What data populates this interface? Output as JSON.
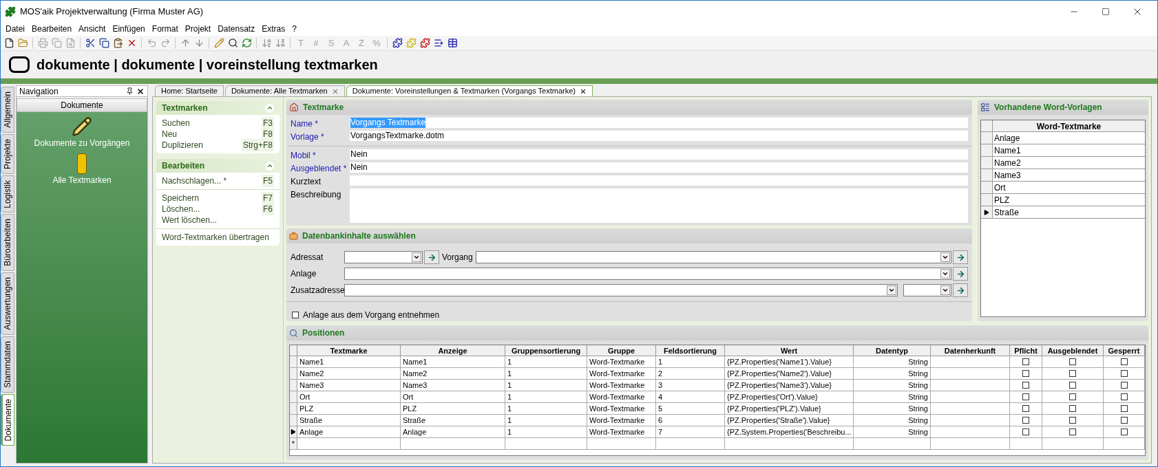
{
  "window": {
    "title": "MOS'aik Projektverwaltung (Firma Muster AG)"
  },
  "menu": [
    "Datei",
    "Bearbeiten",
    "Ansicht",
    "Einfügen",
    "Format",
    "Projekt",
    "Datensatz",
    "Extras",
    "?"
  ],
  "toolbar_glyphs": [
    {
      "label": "T",
      "disabled": true
    },
    {
      "label": "#",
      "disabled": true
    },
    {
      "label": "S",
      "disabled": true
    },
    {
      "label": "A",
      "disabled": true
    },
    {
      "label": "Z",
      "disabled": true
    },
    {
      "label": "%",
      "disabled": true
    }
  ],
  "header": {
    "title": "dokumente | dokumente | voreinstellung textmarken"
  },
  "side_tabs": [
    {
      "label": "Allgemein",
      "selected": false
    },
    {
      "label": "Projekte",
      "selected": false
    },
    {
      "label": "Logistik",
      "selected": false
    },
    {
      "label": "Büroarbeiten",
      "selected": false
    },
    {
      "label": "Auswertungen",
      "selected": false
    },
    {
      "label": "Stammdaten",
      "selected": false
    },
    {
      "label": "Dokumente",
      "selected": true
    }
  ],
  "navigation": {
    "title": "Navigation",
    "group": "Dokumente",
    "items": [
      {
        "label": "Dokumente zu Vorgängen",
        "kind": "pencil"
      },
      {
        "label": "Alle Textmarken",
        "kind": "marker"
      }
    ]
  },
  "doc_tabs": [
    {
      "label": "Home: Startseite",
      "selected": false,
      "closable": false
    },
    {
      "label": "Dokumente: Alle Textmarken",
      "selected": false,
      "closable": true
    },
    {
      "label": "Dokumente: Voreinstellungen & Textmarken (Vorgangs Textmarke)",
      "selected": true,
      "closable": true
    }
  ],
  "task_groups": [
    {
      "title": "Textmarken",
      "sections": [
        [
          {
            "label": "Suchen",
            "shortcut": "F3"
          },
          {
            "label": "Neu",
            "shortcut": "F8"
          },
          {
            "label": "Duplizieren",
            "shortcut": "Strg+F8"
          }
        ]
      ]
    },
    {
      "title": "Bearbeiten",
      "sections": [
        [
          {
            "label": "Nachschlagen... *",
            "shortcut": "F5"
          }
        ],
        [
          {
            "label": "Speichern",
            "shortcut": "F7"
          },
          {
            "label": "Löschen...",
            "shortcut": "F6"
          },
          {
            "label": "Wert löschen..."
          }
        ],
        [
          {
            "label": "Word-Textmarken übertragen"
          }
        ]
      ]
    }
  ],
  "textmarke": {
    "title": "Textmarke",
    "groups": [
      [
        {
          "label": "Name *",
          "required": true,
          "value": "Vorgangs Textmarke",
          "highlighted": true
        },
        {
          "label": "Vorlage *",
          "required": true,
          "value": "VorgangsTextmarke.dotm",
          "highlighted": false
        }
      ],
      [
        {
          "label": "Mobil *",
          "required": true,
          "value": "Nein",
          "highlighted": false
        },
        {
          "label": "Ausgeblendet *",
          "required": true,
          "value": "Nein",
          "highlighted": false
        },
        {
          "label": "Kurztext",
          "required": false,
          "highlighted": false
        },
        {
          "label": "Beschreibung",
          "required": false,
          "highlighted": false,
          "multiline": true
        }
      ]
    ]
  },
  "datenbank": {
    "title": "Datenbankinhalte auswählen",
    "adressat": "Adressat",
    "vorgang": "Vorgang",
    "anlage": "Anlage",
    "zusatzadresse": "Zusatzadresse",
    "checkbox": {
      "label": "Anlage aus dem Vorgang entnehmen",
      "checked": false
    }
  },
  "word_vorlagen": {
    "title": "Vorhandene Word-Vorlagen",
    "column": "Word-Textmarke",
    "rows": [
      {
        "label": "Anlage",
        "selected": false
      },
      {
        "label": "Name1",
        "selected": false
      },
      {
        "label": "Name2",
        "selected": false
      },
      {
        "label": "Name3",
        "selected": false
      },
      {
        "label": "Ort",
        "selected": false
      },
      {
        "label": "PLZ",
        "selected": false
      },
      {
        "label": "Straße",
        "selected": true
      }
    ]
  },
  "positionen": {
    "title": "Positionen",
    "columns": [
      "Textmarke",
      "Anzeige",
      "Gruppensortierung",
      "Gruppe",
      "Feldsortierung",
      "Wert",
      "Datentyp",
      "Datenherkunft",
      "Pflicht",
      "Ausgeblendet",
      "Gesperrt"
    ],
    "rows": [
      {
        "selected": false,
        "cells": [
          "Name1",
          "Name1",
          "1",
          "Word-Textmarke",
          "1",
          "{PZ.Properties('Name1').Value}",
          "String"
        ],
        "pflicht": false,
        "ausgeblendet": false,
        "gesperrt": false
      },
      {
        "selected": false,
        "cells": [
          "Name2",
          "Name2",
          "1",
          "Word-Textmarke",
          "2",
          "{PZ.Properties('Name2').Value}",
          "String"
        ],
        "pflicht": false,
        "ausgeblendet": false,
        "gesperrt": false
      },
      {
        "selected": false,
        "cells": [
          "Name3",
          "Name3",
          "1",
          "Word-Textmarke",
          "3",
          "{PZ.Properties('Name3').Value}",
          "String"
        ],
        "pflicht": false,
        "ausgeblendet": false,
        "gesperrt": false
      },
      {
        "selected": false,
        "cells": [
          "Ort",
          "Ort",
          "1",
          "Word-Textmarke",
          "4",
          "{PZ.Properties('Ort').Value}",
          "String"
        ],
        "pflicht": false,
        "ausgeblendet": false,
        "gesperrt": false
      },
      {
        "selected": false,
        "cells": [
          "PLZ",
          "PLZ",
          "1",
          "Word-Textmarke",
          "5",
          "{PZ.Properties('PLZ').Value}",
          "String"
        ],
        "pflicht": false,
        "ausgeblendet": false,
        "gesperrt": false
      },
      {
        "selected": false,
        "cells": [
          "Straße",
          "Straße",
          "1",
          "Word-Textmarke",
          "6",
          "{PZ.Properties('Straße').Value}",
          "String"
        ],
        "pflicht": false,
        "ausgeblendet": false,
        "gesperrt": false
      },
      {
        "selected": true,
        "cells": [
          "Anlage",
          "Anlage",
          "1",
          "Word-Textmarke",
          "7",
          "{PZ.System.Properties('Beschreibu...",
          "String"
        ],
        "pflicht": false,
        "ausgeblendet": false,
        "gesperrt": false
      }
    ],
    "new_row_marker": "*"
  }
}
